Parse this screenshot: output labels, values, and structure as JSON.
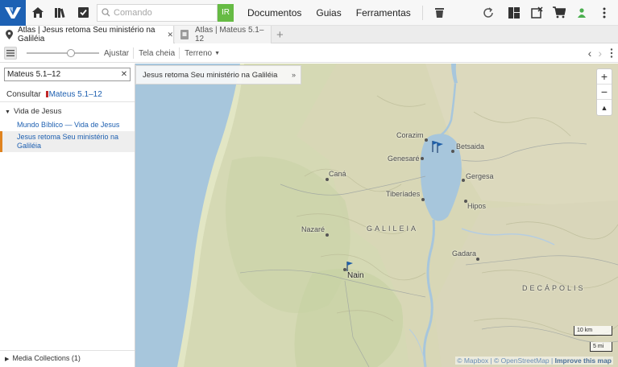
{
  "topbar": {
    "command_placeholder": "Comando",
    "go_label": "IR",
    "menu": [
      "Documentos",
      "Guias",
      "Ferramentas"
    ]
  },
  "tabs": [
    {
      "label": "Atlas | Jesus retoma Seu ministério na Galiléia",
      "close": "✕"
    },
    {
      "label": "Atlas | Mateus 5.1–12"
    }
  ],
  "toolbar": {
    "fit_label": "Ajustar",
    "fullscreen_label": "Tela cheia",
    "terrain_label": "Terreno"
  },
  "sidebar": {
    "search_value": "Mateus 5.1–12",
    "consult_label": "Consultar",
    "consult_ref": "Mateus 5.1–12",
    "group_label": "Vida de Jesus",
    "items": [
      {
        "label": "Mundo Bíblico — Vida de Jesus"
      },
      {
        "label": "Jesus retoma Seu ministério na Galiléia"
      }
    ],
    "media_label": "Media Collections (1)"
  },
  "map": {
    "title": "Jesus retoma Seu ministério na Galiléia",
    "places": [
      "Corazim",
      "Betsaida",
      "Genesaré",
      "Caná",
      "Gergesa",
      "Tiberíades",
      "Hipos",
      "Nazaré",
      "Gadara",
      "Nain"
    ],
    "regions": [
      "GALILEIA",
      "DECÁPOLIS"
    ],
    "scale_km": "10 km",
    "scale_mi": "5 mi",
    "attribution_mapbox": "© Mapbox",
    "attribution_osm": "© OpenStreetMap",
    "attribution_improve": "Improve this map"
  },
  "colors": {
    "brand": "#1d61b4",
    "go_button": "#66bb44",
    "active_item": "#e0831f",
    "water": "#a7c6dc",
    "land": "#d6d8b4"
  }
}
